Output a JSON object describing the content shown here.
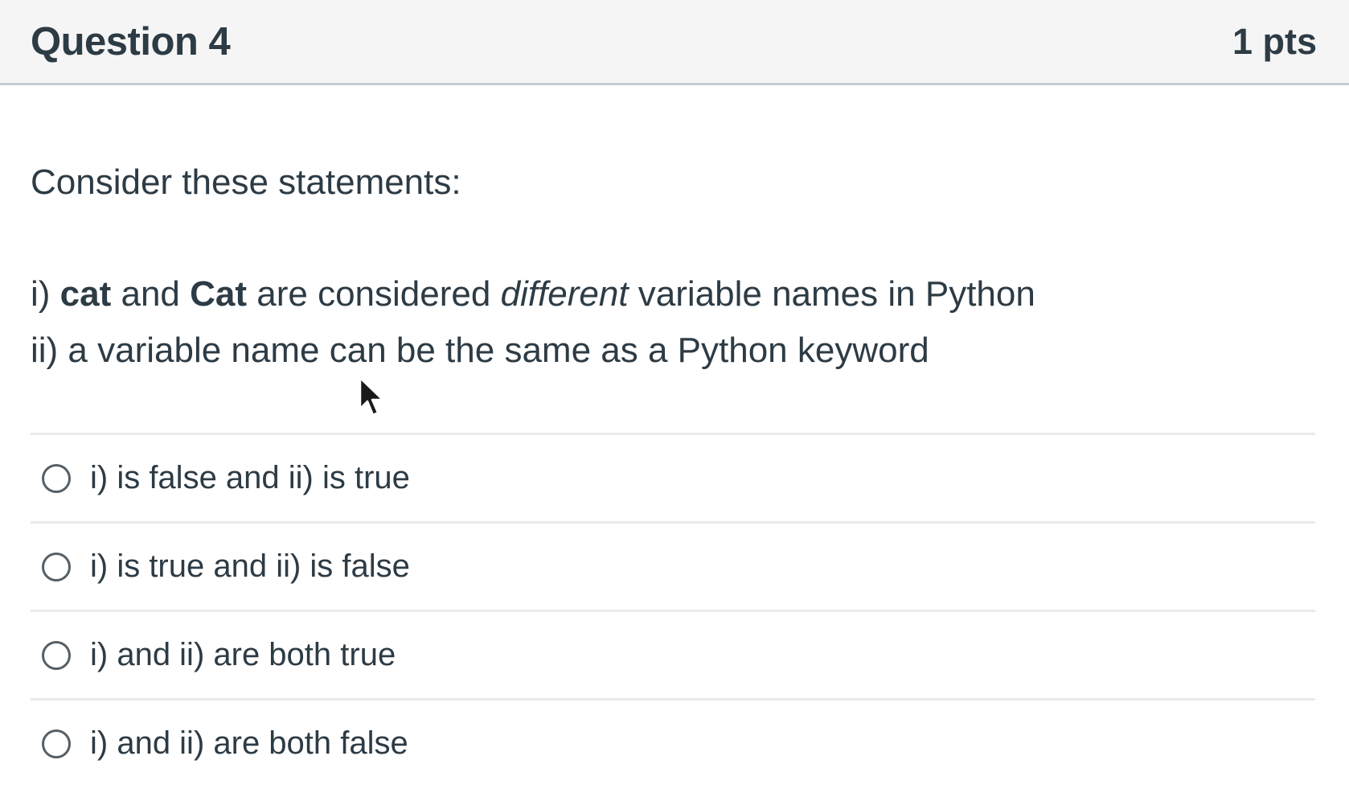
{
  "question": {
    "title": "Question 4",
    "points": "1 pts",
    "intro": "Consider these statements:",
    "statements": [
      {
        "prefix": "i) ",
        "bold1": "cat",
        "mid1": " and ",
        "bold2": "Cat",
        "mid2": " are considered ",
        "italic": "different",
        "end": " variable names in Python"
      },
      {
        "text": "ii) a variable name can be the same as a Python keyword"
      }
    ],
    "answers": [
      {
        "label": "i) is false and ii) is true"
      },
      {
        "label": "i) is true and ii) is false"
      },
      {
        "label": "i) and ii) are both true"
      },
      {
        "label": "i) and ii) are both false"
      }
    ]
  },
  "colors": {
    "header_bg": "#f5f5f5",
    "text": "#2d3b45",
    "divider": "#e8eaec"
  },
  "icons": {
    "cursor": "mouse-pointer-icon",
    "radio": "radio-button-unselected"
  }
}
